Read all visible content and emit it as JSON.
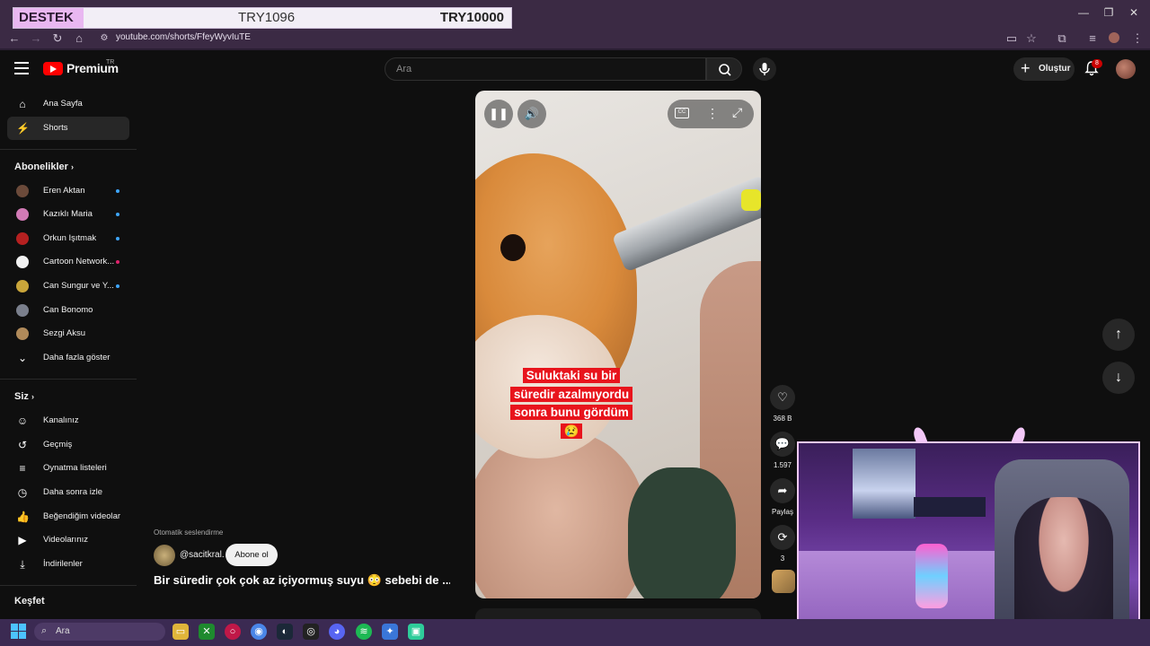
{
  "overlay": {
    "left": "DESTEK <3",
    "middle": "TRY1096",
    "right": "TRY10000"
  },
  "browser": {
    "url": "youtube.com/shorts/FfeyWyvIuTE"
  },
  "header": {
    "logo": "Premium",
    "logo_country": "TR",
    "search_placeholder": "Ara",
    "create_label": "Oluştur",
    "notif_count": "8"
  },
  "sidebar": {
    "main": [
      {
        "label": "Ana Sayfa",
        "icon": "home-icon"
      },
      {
        "label": "Shorts",
        "icon": "shorts-icon"
      }
    ],
    "subscriptions_title": "Abonelikler",
    "subscriptions": [
      {
        "label": "Eren Aktan",
        "color": "#6b4a3a"
      },
      {
        "label": "Kazıklı Maria",
        "color": "#d17ab5"
      },
      {
        "label": "Orkun Işıtmak",
        "color": "#b52020"
      },
      {
        "label": "Cartoon Network...",
        "color": "#f1f1f1"
      },
      {
        "label": "Can Sungur ve Y...",
        "color": "#c9a53a"
      },
      {
        "label": "Can Bonomo",
        "color": "#7a7f8c"
      },
      {
        "label": "Sezgi Aksu",
        "color": "#b08a5a"
      }
    ],
    "show_more": "Daha fazla göster",
    "you_title": "Siz",
    "you": [
      {
        "label": "Kanalınız",
        "icon": "channel-icon"
      },
      {
        "label": "Geçmiş",
        "icon": "history-icon"
      },
      {
        "label": "Oynatma listeleri",
        "icon": "playlists-icon"
      },
      {
        "label": "Daha sonra izle",
        "icon": "watch-later-icon"
      },
      {
        "label": "Beğendiğim videolar",
        "icon": "liked-icon"
      },
      {
        "label": "Videolarınız",
        "icon": "your-videos-icon"
      },
      {
        "label": "İndirilenler",
        "icon": "downloads-icon"
      }
    ],
    "explore_title": "Keşfet"
  },
  "video": {
    "caption_line1": "Suluktaki su bir",
    "caption_line2": "süredir azalmıyordu",
    "caption_line3": "sonra bunu gördüm",
    "caption_emoji": "😢",
    "auto_dub": "Otomatik seslendirme",
    "channel": "@sacitkral.",
    "subscribe": "Abone ol",
    "title": "Bir süredir çok çok az içiyormuş suyu 😳 sebebi de ..."
  },
  "actions": {
    "likes": "368 B",
    "comments": "1.597",
    "share": "Paylaş",
    "remix": "3"
  },
  "taskbar": {
    "search_placeholder": "Ara"
  }
}
